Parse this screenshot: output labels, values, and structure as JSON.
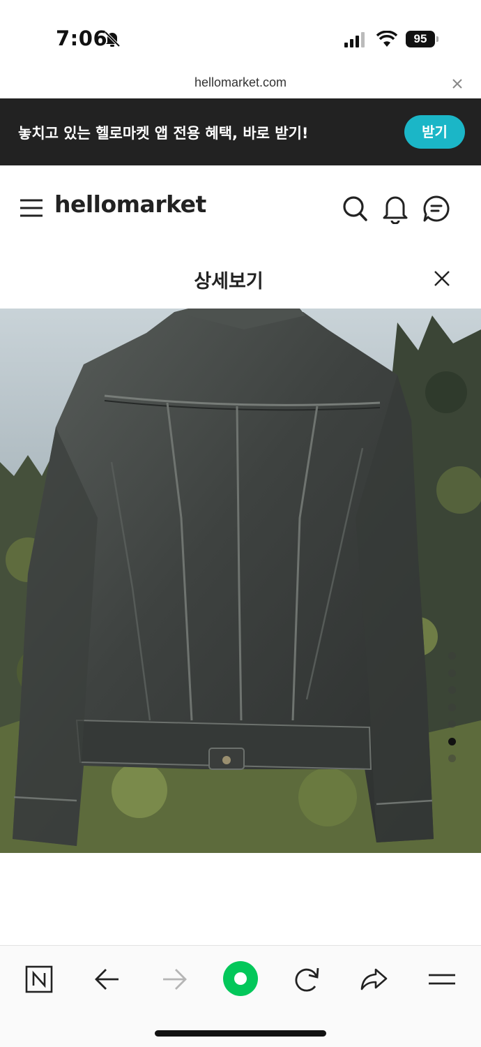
{
  "status_bar": {
    "time": "7:06",
    "battery_level": "95"
  },
  "browser": {
    "url": "hellomarket.com"
  },
  "app_banner": {
    "message": "놓치고 있는 헬로마켓 앱 전용 혜택, 바로 받기!",
    "button_label": "받기",
    "button_color": "#1bb6c7"
  },
  "header": {
    "logo_text": "hellomarket"
  },
  "detail": {
    "title": "상세보기"
  },
  "gallery": {
    "image_count": 7,
    "active_index": 6
  },
  "toolbar": {
    "items": [
      "naver-home-icon",
      "back-arrow-icon",
      "forward-arrow-icon",
      "naver-green-dot-icon",
      "reload-icon",
      "share-icon",
      "menu-icon"
    ],
    "accent_color": "#03c75a"
  }
}
